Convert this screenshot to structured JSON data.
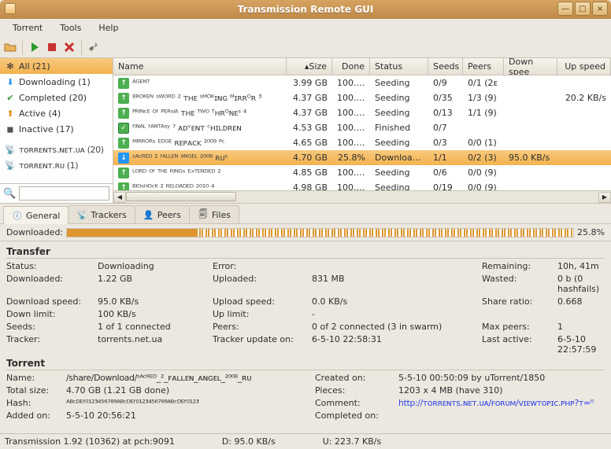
{
  "window": {
    "title": "Transmission Remote GUI"
  },
  "menus": {
    "torrent": "Torrent",
    "tools": "Tools",
    "help": "Help"
  },
  "filters": {
    "all": "All (21)",
    "downloading": "Downloading (1)",
    "completed": "Completed (20)",
    "active": "Active (4)",
    "inactive": "Inactive (17)",
    "tracker1": "ᴛᴏʀʀᴇɴᴛs.ɴᴇᴛ.ᴜᴀ (20)",
    "tracker2": "ᴛᴏʀʀᴇɴᴛ.ʀᴜ (1)"
  },
  "columns": {
    "name": "Name",
    "size": "Size",
    "done": "Done",
    "status": "Status",
    "seeds": "Seeds",
    "peers": "Peers",
    "down": "Down spee",
    "up": "Up speed"
  },
  "rows": [
    {
      "name": "ᴬᴳᴱᴺᵀ",
      "size": "3.99 GB",
      "done": "100.0%",
      "status": "Seeding",
      "seeds": "0/9",
      "peers": "0/1 (2ᴇ",
      "down": "",
      "up": "",
      "kind": "seed"
    },
    {
      "name": "ᴮᴿᴼᴷᴱᴺ ˢᵂᴼᴿᴰ ² ᴛʜᴇ ˢᴹᴼᴷɪɴɢ ᴹɪʀʀᴼʀ ³",
      "size": "4.37 GB",
      "done": "100.0%",
      "status": "Seeding",
      "seeds": "0/35",
      "peers": "1/3 (9)",
      "down": "",
      "up": "20.2 KB/s",
      "kind": "seed"
    },
    {
      "name": "ᴾᴿᴵᴺᶜᴱ ᴼᶠ ᴾᴱᴿˢᴵᴬ ᴛʜᴇ ᵀᵂᴼ ᵀʜʀᴼɴᴇˢ ⁴",
      "size": "4.37 GB",
      "done": "100.0%",
      "status": "Seeding",
      "seeds": "0/13",
      "peers": "1/1 (9)",
      "down": "",
      "up": "",
      "kind": "seed"
    },
    {
      "name": "ᶠᴵᴺᴬᴸ ᶠᴬᴺᵀᴬˢʸ ⁷ ᴀᴅᵛᴇɴᴛ ᶜʜɪʟᴅʀᴇɴ",
      "size": "4.53 GB",
      "done": "100.0%",
      "status": "Finished",
      "seeds": "0/7",
      "peers": "",
      "down": "",
      "up": "",
      "kind": "done"
    },
    {
      "name": "ᴹᴵᴿᴿᴼᴿˢ ᴱᴰᴳᴱ ʀᴇᴘᴀᴄᴋ ²⁰⁰⁹ ᴾᶜ",
      "size": "4.65 GB",
      "done": "100.0%",
      "status": "Seeding",
      "seeds": "0/3",
      "peers": "0/0 (1)",
      "down": "",
      "up": "",
      "kind": "seed"
    },
    {
      "name": "ˢᴬᶜᴿᴱᴰ ² ᶠᴬᴸᴸᴱᴺ ᴬᴺᴳᴱᴸ ²⁰⁰⁸ ʀᴜˢ",
      "size": "4.70 GB",
      "done": "25.8%",
      "status": "Downloading",
      "seeds": "1/1",
      "peers": "0/2 (3)",
      "down": "95.0 KB/s",
      "up": "",
      "kind": "dl",
      "selected": true
    },
    {
      "name": "ᴸᴼᴿᴰ ᴼᶠ ᵀᴴᴱ ᴿᴵᴺᴳˢ ᴱˣᵀᴱᴺᴰᴱᴰ ²",
      "size": "4.85 GB",
      "done": "100.0%",
      "status": "Seeding",
      "seeds": "0/6",
      "peers": "0/0 (9)",
      "down": "",
      "up": "",
      "kind": "seed"
    },
    {
      "name": "ᴮᴵᴼˢᴴᴼᶜᴷ ² ᴿᴱᴸᴼᴬᴰᴱᴰ ²⁰¹⁰ ⁴",
      "size": "4.98 GB",
      "done": "100.0%",
      "status": "Seeding",
      "seeds": "0/19",
      "peers": "0/0 (9)",
      "down": "",
      "up": "",
      "kind": "seed"
    }
  ],
  "tabs": {
    "general": "General",
    "trackers": "Trackers",
    "peers": "Peers",
    "files": "Files"
  },
  "downloaded_label": "Downloaded:",
  "downloaded_pct": "25.8%",
  "transfer": {
    "header": "Transfer",
    "status_l": "Status:",
    "status": "Downloading",
    "error_l": "Error:",
    "error": "",
    "remaining_l": "Remaining:",
    "remaining": "10h, 41m",
    "downloaded_l": "Downloaded:",
    "downloaded": "1.22 GB",
    "uploaded_l": "Uploaded:",
    "uploaded": "831 MB",
    "wasted_l": "Wasted:",
    "wasted": "0 b (0 hashfails)",
    "downspeed_l": "Download speed:",
    "downspeed": "95.0 KB/s",
    "upspeed_l": "Upload speed:",
    "upspeed": "0.0 KB/s",
    "ratio_l": "Share ratio:",
    "ratio": "0.668",
    "downlimit_l": "Down limit:",
    "downlimit": "100 KB/s",
    "uplimit_l": "Up limit:",
    "uplimit": "-",
    "seeds_l": "Seeds:",
    "seeds": "1 of 1 connected",
    "peers_l": "Peers:",
    "peers": "0 of 2 connected (3 in swarm)",
    "maxpeers_l": "Max peers:",
    "maxpeers": "1",
    "tracker_l": "Tracker:",
    "tracker": "torrents.net.ua",
    "trackerupd_l": "Tracker update on:",
    "trackerupd": "6-5-10 22:58:31",
    "lastactive_l": "Last active:",
    "lastactive": "6-5-10 22:57:59"
  },
  "torrent": {
    "header": "Torrent",
    "name_l": "Name:",
    "name": "/share/Download/ˢᴬᶜᴿᴱᴰ_²_ꜰᴀʟʟᴇɴ_ᴀɴɢᴇʟ_²⁰⁰⁸_ʀᴜ",
    "created_l": "Created on:",
    "created": "5-5-10 00:50:09 by uTorrent/1850",
    "total_l": "Total size:",
    "total": "4.70 GB (1.21 GB done)",
    "pieces_l": "Pieces:",
    "pieces": "1203 x 4 MB (have 310)",
    "hash_l": "Hash:",
    "hash": "ᴬᴮᶜᴰᴱᶠ⁰¹²³⁴⁵⁶⁷⁸⁹ᴬᴮᶜᴰᴱᶠ⁰¹²³⁴⁵⁶⁷⁸⁹ᴬᴮᶜᴰᴱᶠ⁰¹²³",
    "comment_l": "Comment:",
    "comment": "http://ᴛᴏʀʀᴇɴᴛs.ɴᴇᴛ.ᴜᴀ/ꜰᴏʀᴜᴍ/ᴠɪᴇᴡᴛᴏᴘɪᴄ.ᴘʜᴘ?ᴛ=⁰",
    "added_l": "Added on:",
    "added": "5-5-10 20:56:21",
    "completed_l": "Completed on:",
    "completed": ""
  },
  "status": {
    "left": "Transmission 1.92 (10362) at pch:9091",
    "down": "D: 95.0 KB/s",
    "up": "U: 223.7 KB/s"
  }
}
